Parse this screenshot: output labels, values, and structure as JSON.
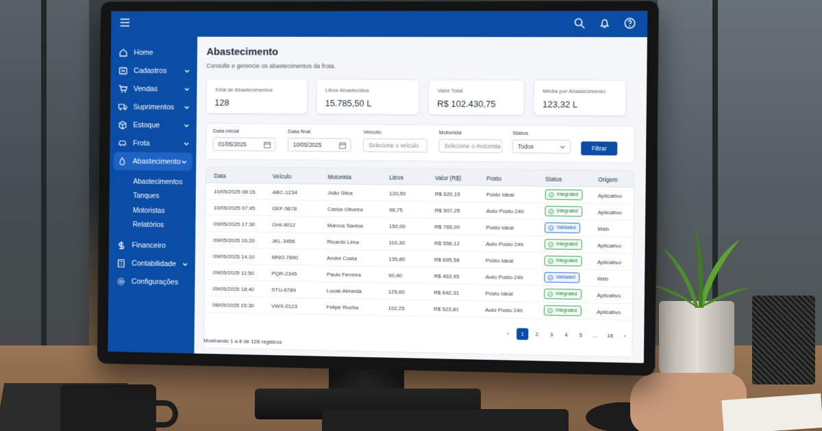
{
  "header": {
    "menu_icon": "hamburger-icon",
    "icons": [
      "search-icon",
      "bell-icon",
      "help-icon"
    ]
  },
  "sidebar": {
    "items": [
      {
        "label": "Home",
        "icon": "home-icon"
      },
      {
        "label": "Cadastros",
        "icon": "id-card-icon",
        "expandable": true
      },
      {
        "label": "Vendas",
        "icon": "cart-icon",
        "expandable": true
      },
      {
        "label": "Suprimentos",
        "icon": "truck-icon",
        "expandable": true
      },
      {
        "label": "Estoque",
        "icon": "box-icon",
        "expandable": true
      },
      {
        "label": "Frota",
        "icon": "car-icon",
        "expandable": true
      },
      {
        "label": "Abastecimento",
        "icon": "fuel-icon",
        "expandable": true,
        "active": true
      }
    ],
    "sub_items": [
      "Abastecimentos",
      "Tanques",
      "Motoristas",
      "Relatórios"
    ],
    "bottom_items": [
      {
        "label": "Financeiro",
        "icon": "dollar-icon"
      },
      {
        "label": "Contabilidade",
        "icon": "calculator-icon",
        "expandable": true
      },
      {
        "label": "Configurações",
        "icon": "gear-icon"
      }
    ]
  },
  "page": {
    "title": "Abastecimento",
    "subtitle": "Consulte e gerencie os abastecimentos da frota."
  },
  "cards": [
    {
      "label": "Total de Abastecimentos",
      "value": "128"
    },
    {
      "label": "Litros Abastecidos",
      "value": "15.785,50 L"
    },
    {
      "label": "Valor Total",
      "value": "R$ 102.430,75"
    },
    {
      "label": "Média por Abastecimento",
      "value": "123,32 L"
    }
  ],
  "filters": {
    "start_label": "Data inicial",
    "start_value": "01/05/2025",
    "end_label": "Data final",
    "end_value": "10/05/2025",
    "vehicle_label": "Veículo",
    "vehicle_placeholder": "Selecione o veículo",
    "driver_label": "Motorista",
    "driver_placeholder": "Selecione o motorista",
    "status_label": "Status",
    "status_value": "Todos",
    "button": "Filtrar"
  },
  "table": {
    "columns": [
      "Data",
      "Veículo",
      "Motorista",
      "Litros",
      "Valor (R$)",
      "Posto",
      "Status",
      "Origem"
    ],
    "rows": [
      {
        "date": "10/05/2025 08:15",
        "vehicle": "ABC-1234",
        "driver": "João Silva",
        "liters": "120,50",
        "value": "R$ 620,15",
        "station": "Posto Ideal",
        "status": "Integrated",
        "status_color": "green",
        "origin": "Aplicativo"
      },
      {
        "date": "10/05/2025 07:45",
        "vehicle": "DEF-5678",
        "driver": "Carlos Oliveira",
        "liters": "98,75",
        "value": "R$ 507,25",
        "station": "Auto Posto 24h",
        "status": "Integrated",
        "status_color": "green",
        "origin": "Aplicativo"
      },
      {
        "date": "09/05/2025 17:30",
        "vehicle": "GHI-9012",
        "driver": "Marcos Santos",
        "liters": "150,00",
        "value": "R$ 765,00",
        "station": "Posto Ideal",
        "status": "Validated",
        "status_color": "blue",
        "origin": "Web"
      },
      {
        "date": "09/05/2025 16:20",
        "vehicle": "JKL-3456",
        "driver": "Ricardo Lima",
        "liters": "110,30",
        "value": "R$ 556,12",
        "station": "Auto Posto 24h",
        "status": "Integrated",
        "status_color": "green",
        "origin": "Aplicativo"
      },
      {
        "date": "09/05/2025 14:10",
        "vehicle": "MNO-7890",
        "driver": "André Costa",
        "liters": "135,80",
        "value": "R$ 695,58",
        "station": "Posto Ideal",
        "status": "Integrated",
        "status_color": "green",
        "origin": "Aplicativo"
      },
      {
        "date": "09/05/2025 11:50",
        "vehicle": "PQR-2345",
        "driver": "Paulo Ferreira",
        "liters": "90,40",
        "value": "R$ 463,95",
        "station": "Auto Posto 24h",
        "status": "Validated",
        "status_color": "blue",
        "origin": "Web"
      },
      {
        "date": "09/05/2025 18:40",
        "vehicle": "STU-6789",
        "driver": "Lucas Almeida",
        "liters": "125,60",
        "value": "R$ 642,31",
        "station": "Posto Ideal",
        "status": "Integrated",
        "status_color": "green",
        "origin": "Aplicativo"
      },
      {
        "date": "08/05/2025 15:30",
        "vehicle": "VWX-0123",
        "driver": "Felipe Rocha",
        "liters": "102,25",
        "value": "R$ 523,81",
        "station": "Auto Posto 24h",
        "status": "Integrated",
        "status_color": "green",
        "origin": "Aplicativo"
      }
    ]
  },
  "footer": {
    "summary": "Mostrando 1 a 8 de 128 registros",
    "pages": [
      "‹",
      "1",
      "2",
      "3",
      "4",
      "5",
      "...",
      "16",
      "›"
    ],
    "current_page": "1"
  },
  "colors": {
    "brand": "#0a4da6",
    "sidebar_active": "#1e63c4",
    "badge_green": "#3aa55b",
    "badge_blue": "#2f72d6"
  }
}
